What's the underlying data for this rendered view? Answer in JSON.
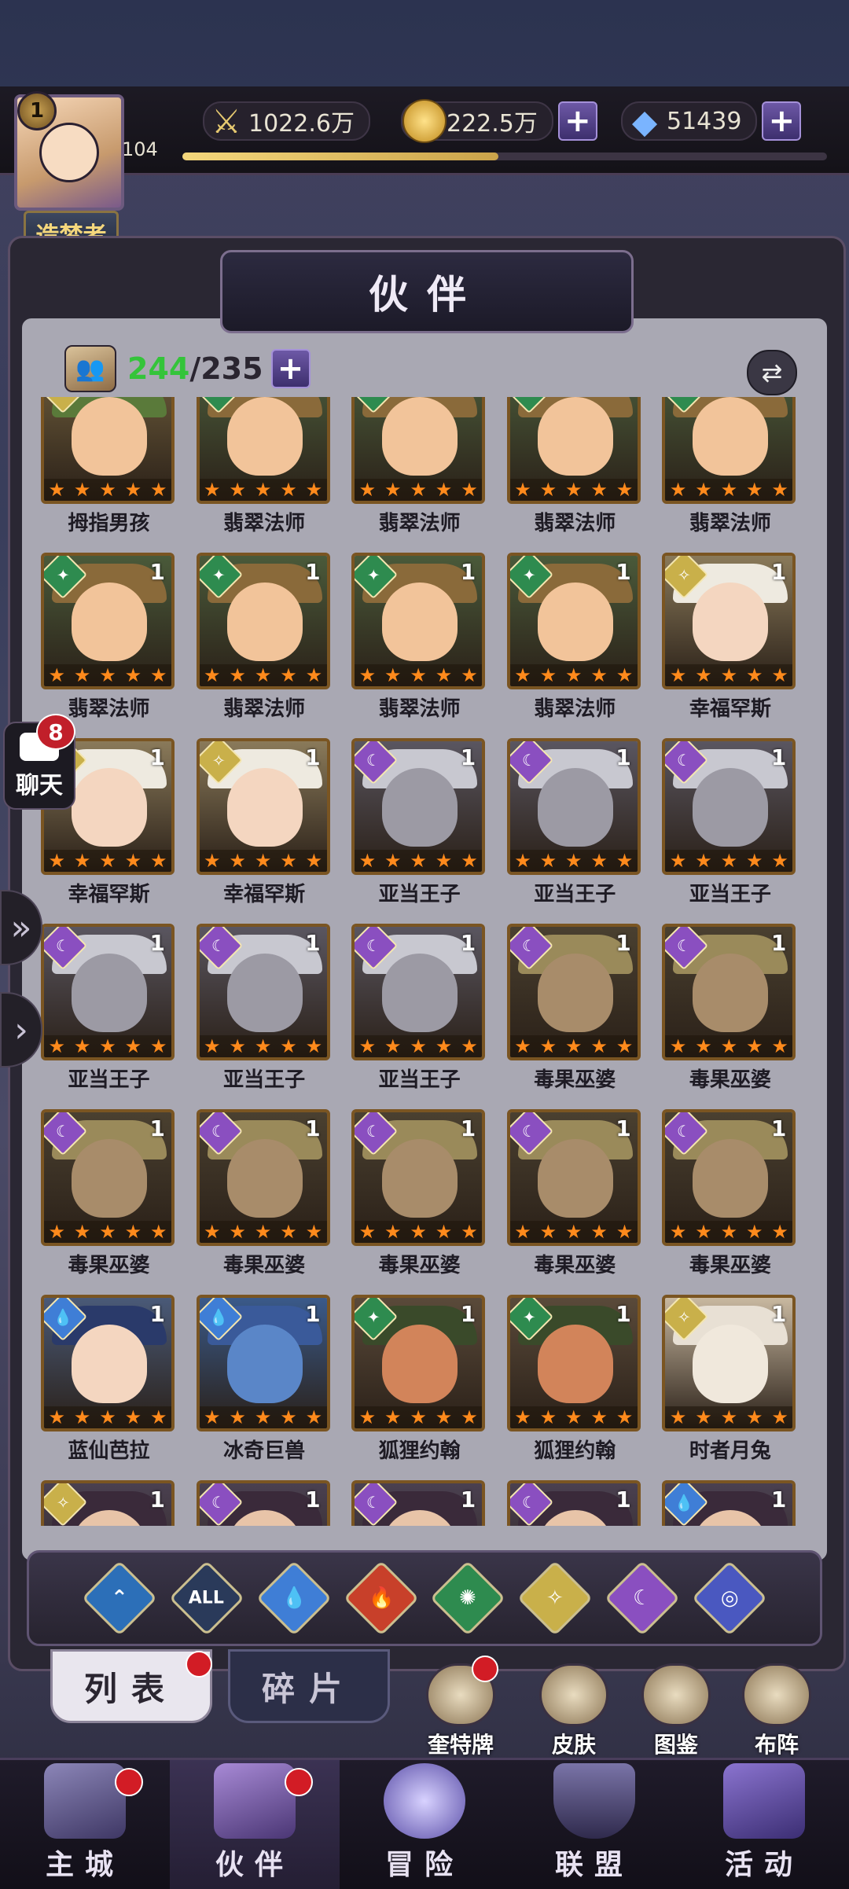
{
  "player": {
    "rank": "1",
    "level": "104",
    "title": "造梦者",
    "exp_fraction": 0.49
  },
  "resources": {
    "power": "1022.6万",
    "gold": "222.5万",
    "diamond": "51439"
  },
  "panel": {
    "title": "伙伴",
    "owned": "244",
    "capacity": "/235",
    "plus": "+"
  },
  "side": {
    "chat_badge": "8",
    "chat_label": "聊天"
  },
  "grid_rows": [
    [
      "拇指男孩",
      "翡翠法师",
      "翡翠法师",
      "翡翠法师",
      "翡翠法师"
    ],
    [
      "翡翠法师",
      "翡翠法师",
      "翡翠法师",
      "翡翠法师",
      "幸福罕斯"
    ],
    [
      "幸福罕斯",
      "幸福罕斯",
      "亚当王子",
      "亚当王子",
      "亚当王子"
    ],
    [
      "亚当王子",
      "亚当王子",
      "亚当王子",
      "毒果巫婆",
      "毒果巫婆"
    ],
    [
      "毒果巫婆",
      "毒果巫婆",
      "毒果巫婆",
      "毒果巫婆",
      "毒果巫婆"
    ],
    [
      "蓝仙芭拉",
      "冰奇巨兽",
      "狐狸约翰",
      "狐狸约翰",
      "时者月兔"
    ],
    [
      "",
      "",
      "",
      "",
      ""
    ]
  ],
  "card_level": "1",
  "filters": [
    "water-up",
    "ALL",
    "water",
    "fire",
    "wind",
    "light",
    "moon",
    "cosmic"
  ],
  "tabs": {
    "list": "列表",
    "fragments": "碎片"
  },
  "shortcuts": [
    "奎特牌",
    "皮肤",
    "图鉴",
    "布阵"
  ],
  "nav": [
    "主城",
    "伙伴",
    "冒险",
    "联盟",
    "活动"
  ],
  "colors": {
    "wind": "#2e8b4f",
    "light": "#c9b04a",
    "moon": "#8a4fc0",
    "water": "#3f7ed6",
    "fire": "#d2452a",
    "accent": "#34c43a"
  }
}
